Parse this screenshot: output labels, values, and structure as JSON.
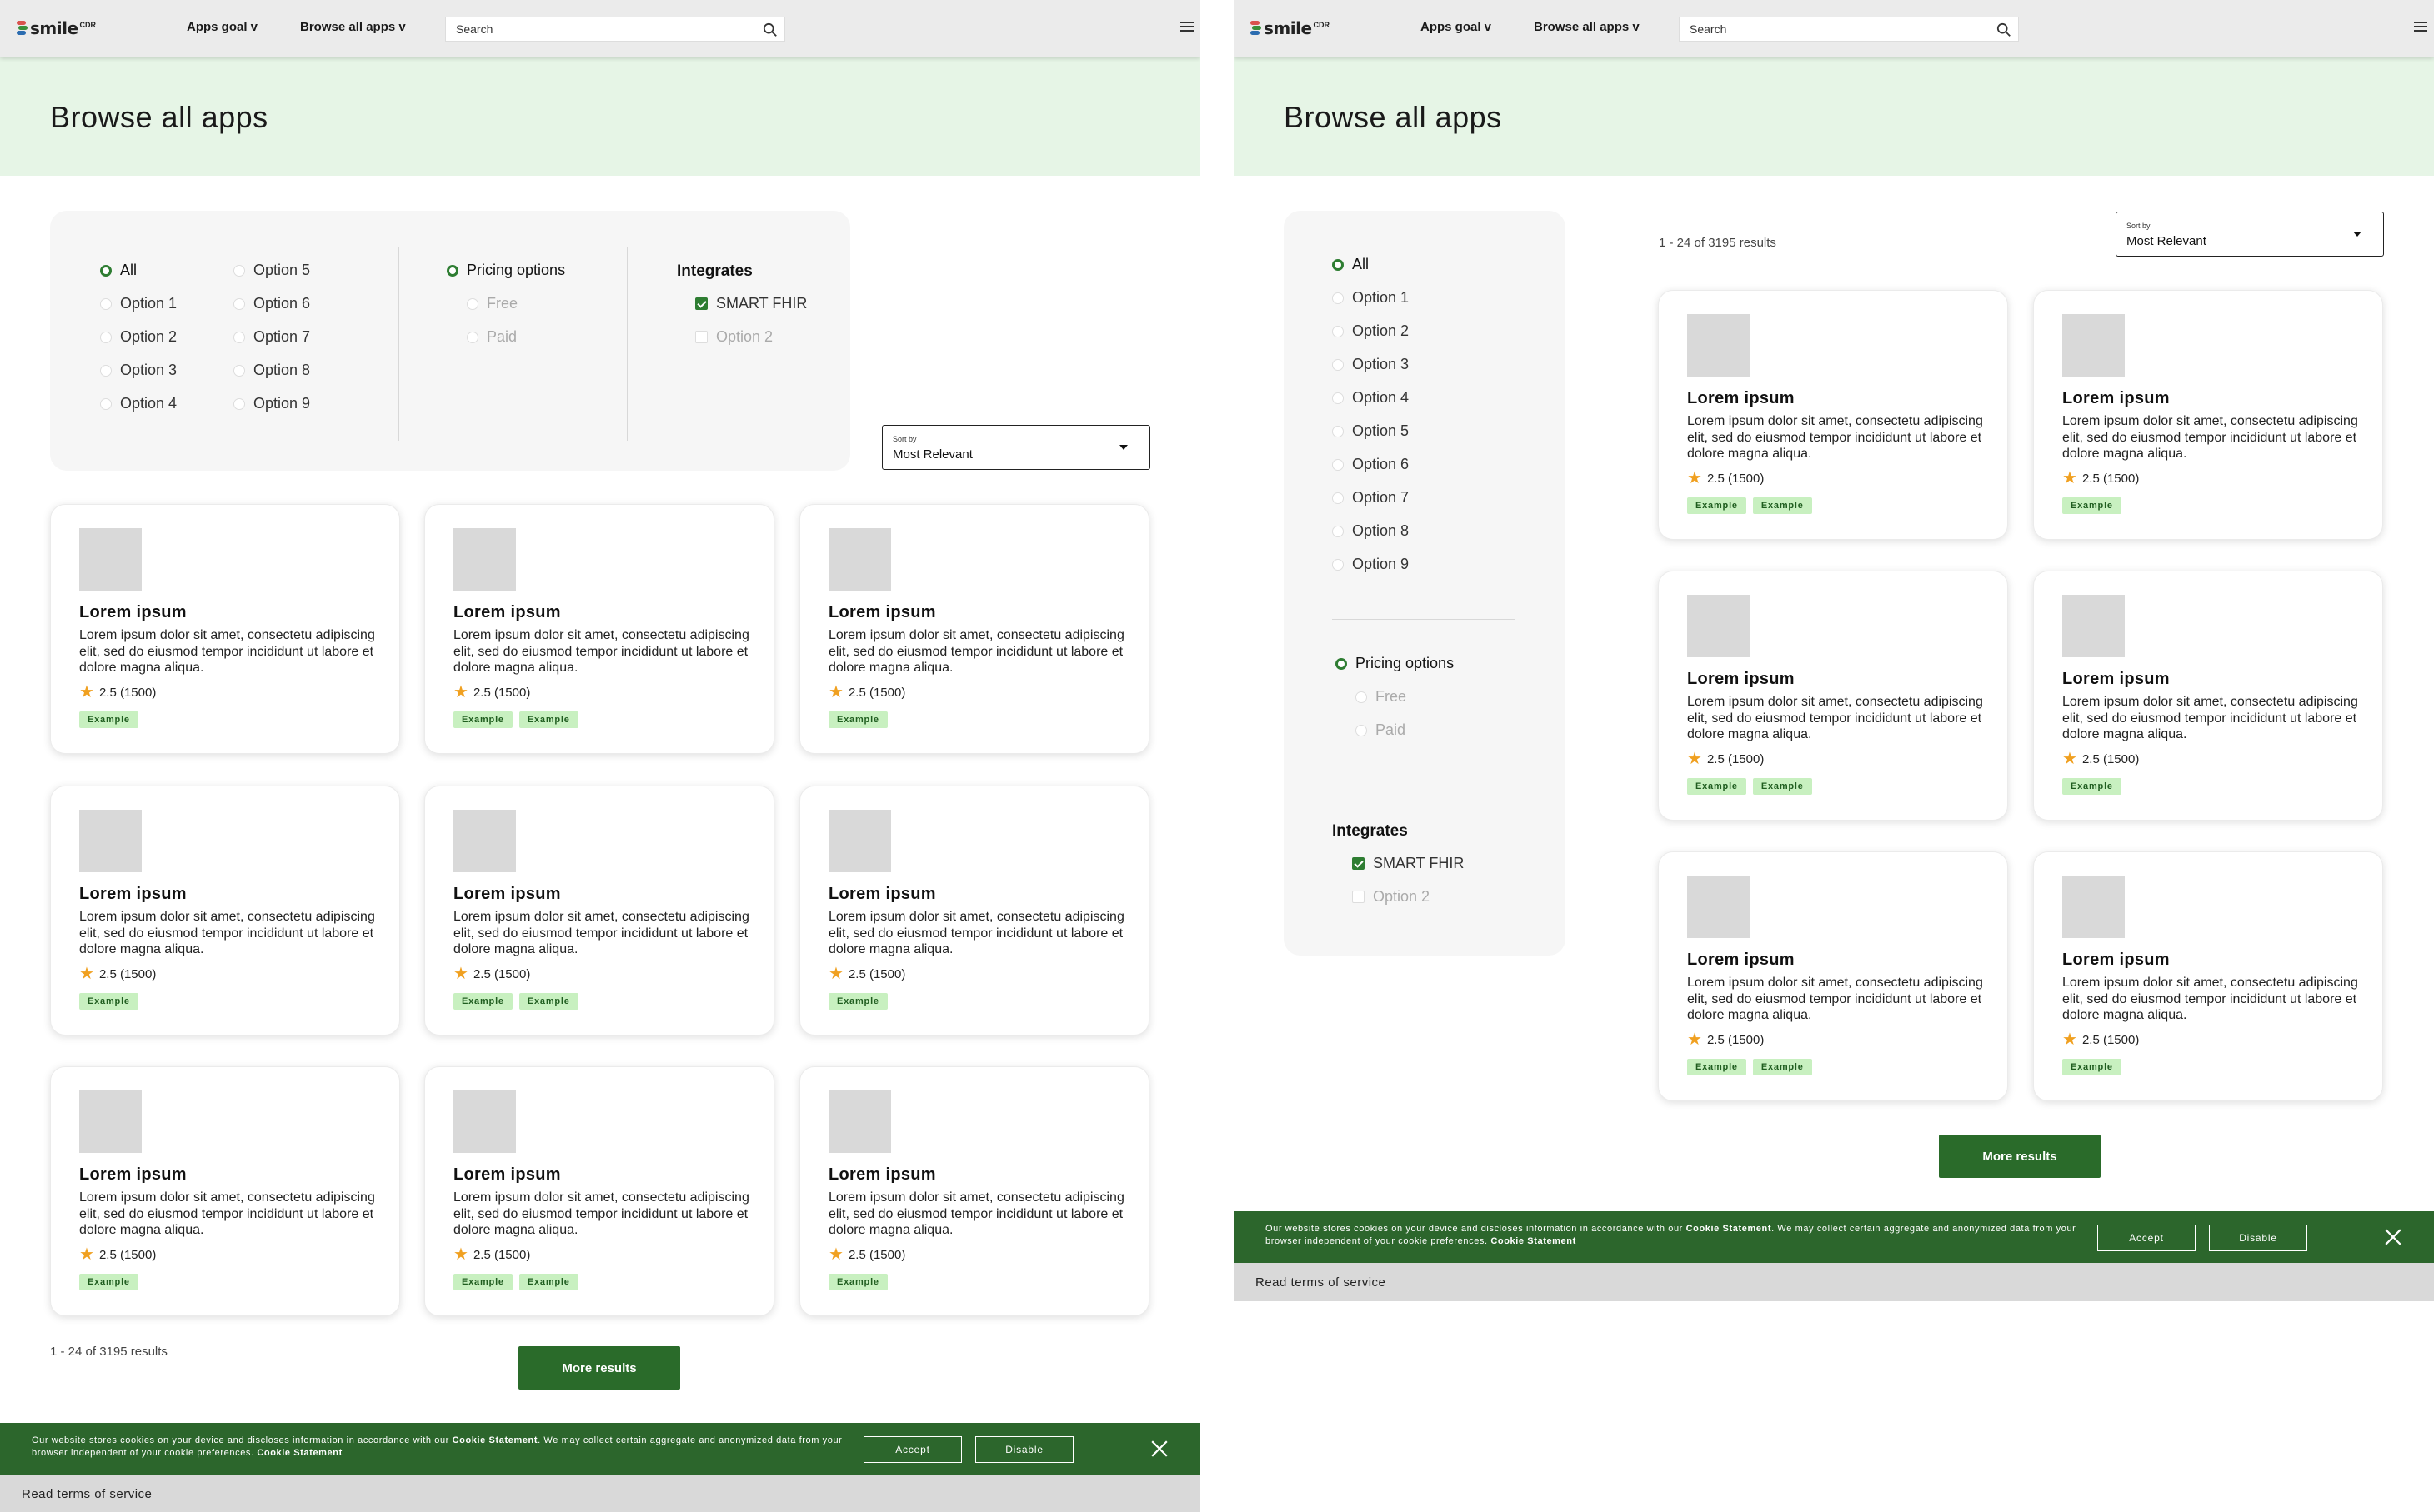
{
  "header": {
    "logo_text": "smile",
    "logo_sub": "CDR",
    "nav_apps_goal": "Apps goal v",
    "nav_browse_all": "Browse all apps v",
    "search_placeholder": "Search"
  },
  "banner": {
    "title": "Browse all apps"
  },
  "filters": {
    "categories": [
      "All",
      "Option 1",
      "Option 2",
      "Option 3",
      "Option 4",
      "Option 5",
      "Option 6",
      "Option 7",
      "Option 8",
      "Option 9"
    ],
    "selected_category": "All",
    "pricing_title": "Pricing options",
    "pricing_options": [
      "Free",
      "Paid"
    ],
    "integrates_title": "Integrates",
    "integrates_options": [
      "SMART FHIR",
      "Option 2"
    ],
    "integrates_checked": [
      "SMART FHIR"
    ]
  },
  "sort": {
    "label": "Sort by",
    "value": "Most Relevant"
  },
  "results": {
    "count_text": "1 - 24 of 3195 results",
    "more_button": "More results"
  },
  "cards": [
    {
      "title": "Lorem ipsum",
      "description": "Lorem ipsum dolor sit amet, consectetu adipiscing elit, sed do eiusmod tempor incididunt ut labore et dolore magna aliqua.",
      "rating": "2.5 (1500)",
      "tags": [
        "Example"
      ]
    },
    {
      "title": "Lorem ipsum",
      "description": "Lorem ipsum dolor sit amet, consectetu adipiscing elit, sed do eiusmod tempor incididunt ut labore et dolore magna aliqua.",
      "rating": "2.5 (1500)",
      "tags": [
        "Example",
        "Example"
      ]
    },
    {
      "title": "Lorem ipsum",
      "description": "Lorem ipsum dolor sit amet, consectetu adipiscing elit, sed do eiusmod tempor incididunt ut labore et dolore magna aliqua.",
      "rating": "2.5 (1500)",
      "tags": [
        "Example"
      ]
    },
    {
      "title": "Lorem ipsum",
      "description": "Lorem ipsum dolor sit amet, consectetu adipiscing elit, sed do eiusmod tempor incididunt ut labore et dolore magna aliqua.",
      "rating": "2.5 (1500)",
      "tags": [
        "Example"
      ]
    },
    {
      "title": "Lorem ipsum",
      "description": "Lorem ipsum dolor sit amet, consectetu adipiscing elit, sed do eiusmod tempor incididunt ut labore et dolore magna aliqua.",
      "rating": "2.5 (1500)",
      "tags": [
        "Example",
        "Example"
      ]
    },
    {
      "title": "Lorem ipsum",
      "description": "Lorem ipsum dolor sit amet, consectetu adipiscing elit, sed do eiusmod tempor incididunt ut labore et dolore magna aliqua.",
      "rating": "2.5 (1500)",
      "tags": [
        "Example"
      ]
    },
    {
      "title": "Lorem ipsum",
      "description": "Lorem ipsum dolor sit amet, consectetu adipiscing elit, sed do eiusmod tempor incididunt ut labore et dolore magna aliqua.",
      "rating": "2.5 (1500)",
      "tags": [
        "Example"
      ]
    },
    {
      "title": "Lorem ipsum",
      "description": "Lorem ipsum dolor sit amet, consectetu adipiscing elit, sed do eiusmod tempor incididunt ut labore et dolore magna aliqua.",
      "rating": "2.5 (1500)",
      "tags": [
        "Example",
        "Example"
      ]
    },
    {
      "title": "Lorem ipsum",
      "description": "Lorem ipsum dolor sit amet, consectetu adipiscing elit, sed do eiusmod tempor incididunt ut labore et dolore magna aliqua.",
      "rating": "2.5 (1500)",
      "tags": [
        "Example"
      ]
    }
  ],
  "cards_b": [
    {
      "title": "Lorem ipsum",
      "description": "Lorem ipsum dolor sit amet, consectetu adipiscing elit, sed do eiusmod tempor incididunt ut labore et dolore magna aliqua.",
      "rating": "2.5 (1500)",
      "tags": [
        "Example",
        "Example"
      ]
    },
    {
      "title": "Lorem ipsum",
      "description": "Lorem ipsum dolor sit amet, consectetu adipiscing elit, sed do eiusmod tempor incididunt ut labore et dolore magna aliqua.",
      "rating": "2.5 (1500)",
      "tags": [
        "Example"
      ]
    },
    {
      "title": "Lorem ipsum",
      "description": "Lorem ipsum dolor sit amet, consectetu adipiscing elit, sed do eiusmod tempor incididunt ut labore et dolore magna aliqua.",
      "rating": "2.5 (1500)",
      "tags": [
        "Example",
        "Example"
      ]
    },
    {
      "title": "Lorem ipsum",
      "description": "Lorem ipsum dolor sit amet, consectetu adipiscing elit, sed do eiusmod tempor incididunt ut labore et dolore magna aliqua.",
      "rating": "2.5 (1500)",
      "tags": [
        "Example"
      ]
    },
    {
      "title": "Lorem ipsum",
      "description": "Lorem ipsum dolor sit amet, consectetu adipiscing elit, sed do eiusmod tempor incididunt ut labore et dolore magna aliqua.",
      "rating": "2.5 (1500)",
      "tags": [
        "Example",
        "Example"
      ]
    },
    {
      "title": "Lorem ipsum",
      "description": "Lorem ipsum dolor sit amet, consectetu adipiscing elit, sed do eiusmod tempor incididunt ut labore et dolore magna aliqua.",
      "rating": "2.5 (1500)",
      "tags": [
        "Example"
      ]
    }
  ],
  "cookie": {
    "text_before": "Our website stores cookies on your device and discloses information in accordance with our ",
    "link1": "Cookie Statement",
    "text_middle": ". We may collect certain aggregate and anonymized data from your browser independent of your cookie preferences. ",
    "link2": "Cookie Statement",
    "accept": "Accept",
    "disable": "Disable"
  },
  "footer": {
    "terms": "Read terms of service"
  },
  "colors": {
    "accent": "#2e7d32",
    "banner_bg": "#e6f5e6",
    "tag_bg": "#c8f0c0",
    "cookie_bg": "#2c662c"
  },
  "icons": {
    "search": "search-icon",
    "menu": "hamburger-menu-icon",
    "close": "close-icon",
    "star": "star-icon"
  }
}
